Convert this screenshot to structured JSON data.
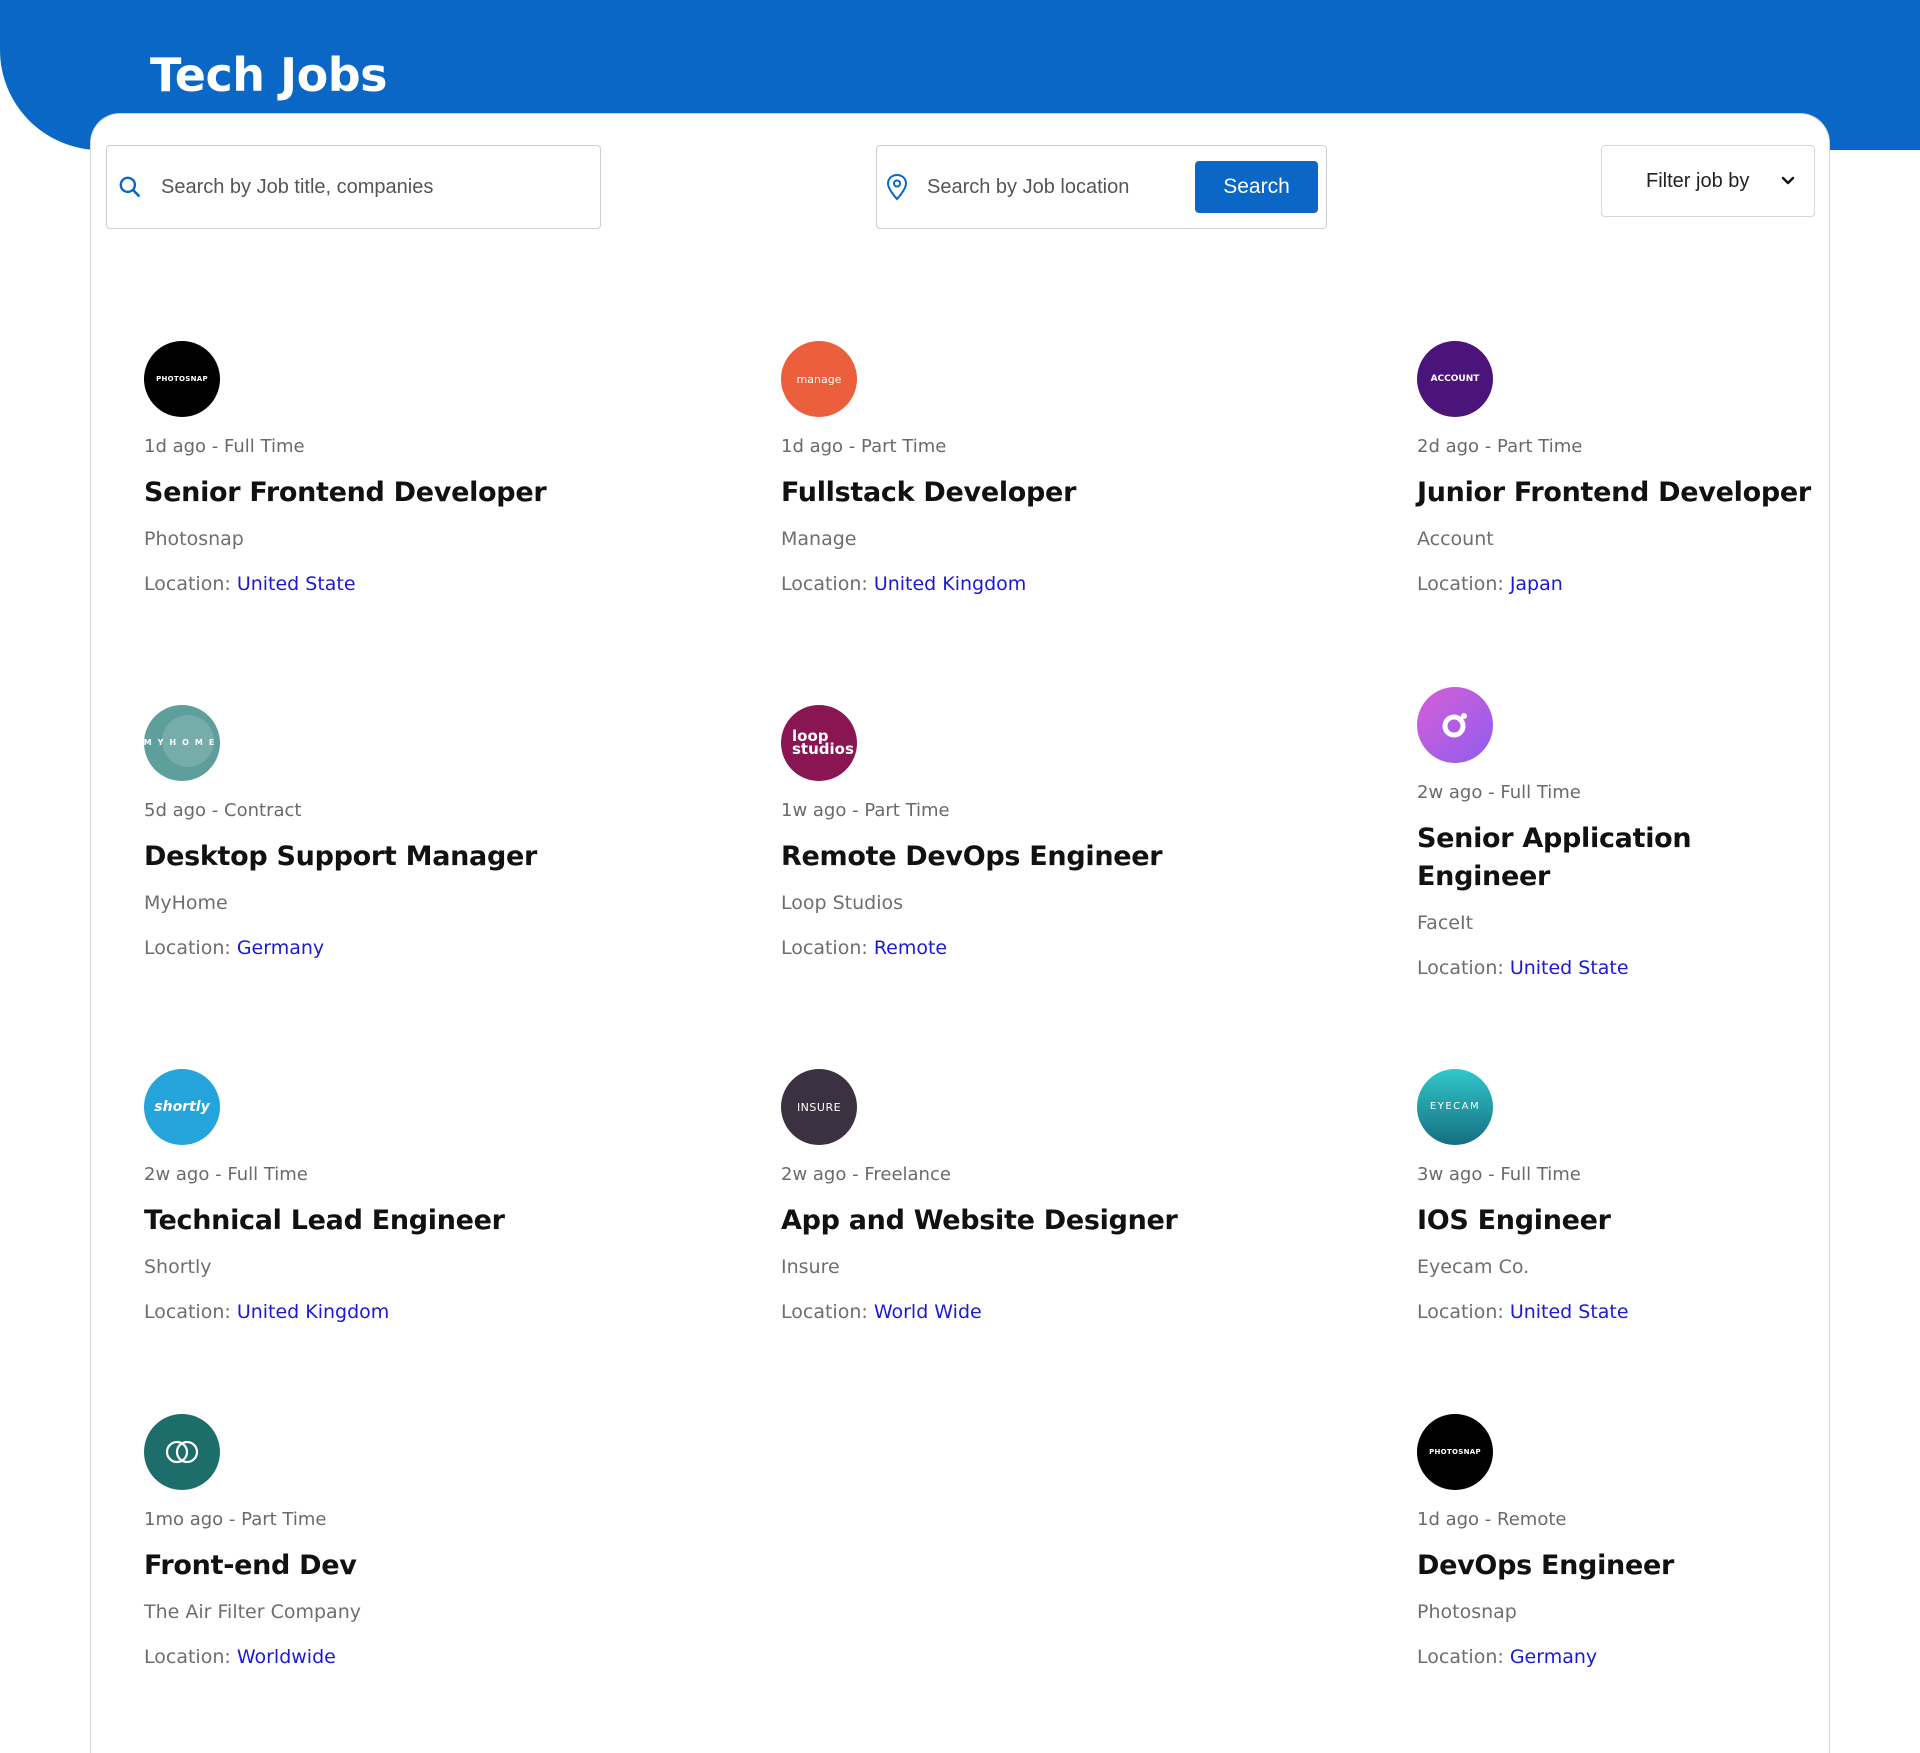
{
  "header": {
    "title": "Tech Jobs",
    "brand_color": "#0b67c5"
  },
  "search": {
    "title_placeholder": "Search by Job title, companies",
    "location_placeholder": "Search by Job location",
    "button_label": "Search"
  },
  "filter": {
    "label": "Filter job by"
  },
  "jobs": [
    {
      "logo_text": "PHOTOSNAP",
      "logo_color": "#000000",
      "posted": "1d ago",
      "type": "Full Time",
      "title": "Senior Frontend Developer",
      "company": "Photosnap",
      "location_label": "Location:",
      "location": "United State"
    },
    {
      "logo_text": "manage",
      "logo_color": "#ec5f3c",
      "posted": "1d ago",
      "type": "Part Time",
      "title": "Fullstack Developer",
      "company": "Manage",
      "location_label": "Location:",
      "location": "United Kingdom"
    },
    {
      "logo_text": "ACCOUNT",
      "logo_color": "#4a147a",
      "posted": "2d ago",
      "type": "Part Time",
      "title": "Junior Frontend Developer",
      "company": "Account",
      "location_label": "Location:",
      "location": "Japan"
    },
    {
      "logo_text": "MYHOME",
      "logo_color": "#5e9e9b",
      "posted": "5d ago",
      "type": "Contract",
      "title": "Desktop Support Manager",
      "company": "MyHome",
      "location_label": "Location:",
      "location": "Germany"
    },
    {
      "logo_text": "loop studios",
      "logo_color": "#8a1553",
      "posted": "1w ago",
      "type": "Part Time",
      "title": "Remote DevOps Engineer",
      "company": "Loop Studios",
      "location_label": "Location:",
      "location": "Remote"
    },
    {
      "logo_text": "",
      "logo_color": "#b15ce0",
      "posted": "2w ago",
      "type": "Full Time",
      "title": "Senior Application Engineer",
      "company": "FaceIt",
      "location_label": "Location:",
      "location": "United State"
    },
    {
      "logo_text": "shortly",
      "logo_color": "#25a4dc",
      "posted": "2w ago",
      "type": "Full Time",
      "title": "Technical Lead Engineer",
      "company": "Shortly",
      "location_label": "Location:",
      "location": "United Kingdom"
    },
    {
      "logo_text": "INSURE",
      "logo_color": "#3b3140",
      "posted": "2w ago",
      "type": "Freelance",
      "title": "App and Website Designer",
      "company": "Insure",
      "location_label": "Location:",
      "location": "World Wide"
    },
    {
      "logo_text": "EYECAM",
      "logo_color": "#1f9aa5",
      "posted": "3w ago",
      "type": "Full Time",
      "title": "IOS Engineer",
      "company": "Eyecam Co.",
      "location_label": "Location:",
      "location": "United State"
    },
    {
      "logo_text": "",
      "logo_color": "#1d6e6a",
      "posted": "1mo ago",
      "type": "Part Time",
      "title": "Front-end Dev",
      "company": "The Air Filter Company",
      "location_label": "Location:",
      "location": "Worldwide"
    },
    {
      "logo_text": "PHOTOSNAP",
      "logo_color": "#000000",
      "posted": "1d ago",
      "type": "Remote",
      "title": "DevOps Engineer",
      "company": "Photosnap",
      "location_label": "Location:",
      "location": "Germany"
    }
  ]
}
